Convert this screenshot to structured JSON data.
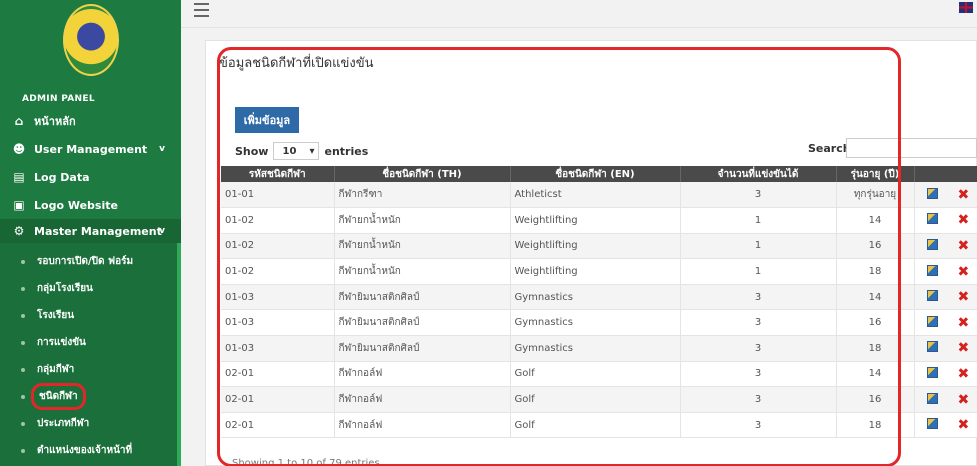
{
  "sidebar": {
    "panel_label": "ADMIN PANEL",
    "menu": [
      {
        "label": "หน้าหลัก",
        "icon": "home-icon"
      },
      {
        "label": "User Management",
        "icon": "users-icon",
        "chevron": "v"
      },
      {
        "label": "Log Data",
        "icon": "log-icon"
      },
      {
        "label": "Logo Website",
        "icon": "image-icon"
      },
      {
        "label": "Master Management",
        "icon": "gears-icon",
        "chevron": "v"
      }
    ],
    "submenu": [
      "รอบการเปิด/ปิด ฟอร์ม",
      "กลุ่มโรงเรียน",
      "โรงเรียน",
      "การแข่งขัน",
      "กลุ่มกีฬา",
      "ชนิดกีฬา",
      "ประเภทกีฬา",
      "ตำแหน่งของเจ้าหน้าที่"
    ],
    "active_submenu_index": 5
  },
  "main": {
    "title": "ข้อมูลชนิดกีฬาที่เปิดแข่งขัน",
    "add_label": "เพิ่มข้อมูล",
    "show_label": "Show",
    "entries_value": "10",
    "entries_label": "entries",
    "search_label": "Search:",
    "search_value": "",
    "info": "Showing 1 to 10 of 79 entries"
  },
  "table": {
    "columns": [
      "รหัสชนิดกีฬา",
      "ชื่อชนิดกีฬา (TH)",
      "ชื่อชนิดกีฬา (EN)",
      "จำนวนที่แข่งขันได้",
      "รุ่นอายุ (ปี)",
      ""
    ],
    "rows": [
      {
        "code": "01-01",
        "th": "กีฬากรีฑา",
        "en": "Athleticst",
        "count": "3",
        "age": "ทุกรุ่นอายุ"
      },
      {
        "code": "01-02",
        "th": "กีฬายกน้ำหนัก",
        "en": "Weightlifting",
        "count": "1",
        "age": "14"
      },
      {
        "code": "01-02",
        "th": "กีฬายกน้ำหนัก",
        "en": "Weightlifting",
        "count": "1",
        "age": "16"
      },
      {
        "code": "01-02",
        "th": "กีฬายกน้ำหนัก",
        "en": "Weightlifting",
        "count": "1",
        "age": "18"
      },
      {
        "code": "01-03",
        "th": "กีฬายิมนาสติกศิลป์",
        "en": "Gymnastics",
        "count": "3",
        "age": "14"
      },
      {
        "code": "01-03",
        "th": "กีฬายิมนาสติกศิลป์",
        "en": "Gymnastics",
        "count": "3",
        "age": "16"
      },
      {
        "code": "01-03",
        "th": "กีฬายิมนาสติกศิลป์",
        "en": "Gymnastics",
        "count": "3",
        "age": "18"
      },
      {
        "code": "02-01",
        "th": "กีฬากอล์ฟ",
        "en": "Golf",
        "count": "3",
        "age": "14"
      },
      {
        "code": "02-01",
        "th": "กีฬากอล์ฟ",
        "en": "Golf",
        "count": "3",
        "age": "16"
      },
      {
        "code": "02-01",
        "th": "กีฬากอล์ฟ",
        "en": "Golf",
        "count": "3",
        "age": "18"
      }
    ]
  },
  "colors": {
    "sidebar": "#1d7a40",
    "accent_button": "#2e6aa8",
    "highlight": "#e2262a",
    "header": "#4a4a4a"
  }
}
